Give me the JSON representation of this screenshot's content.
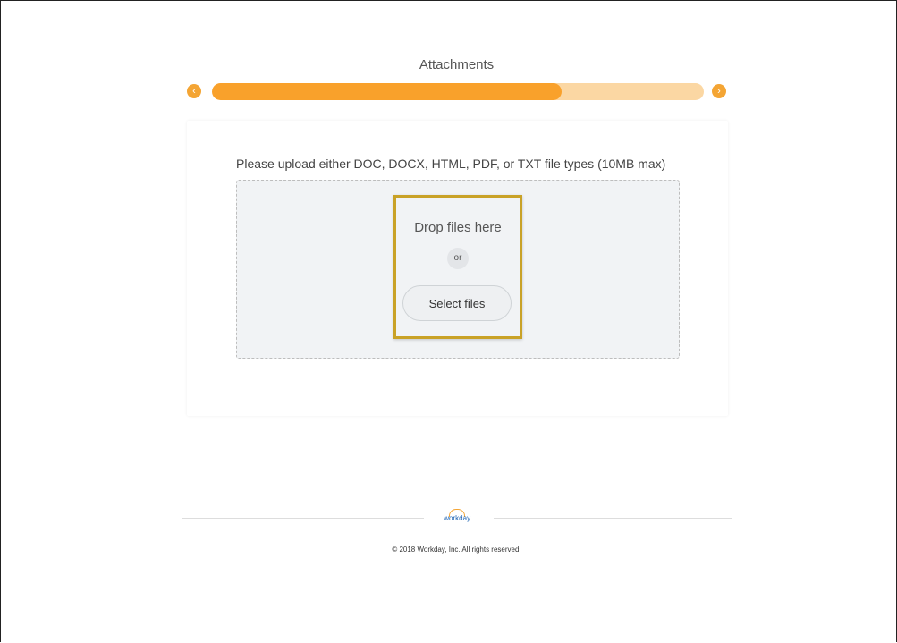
{
  "step": {
    "title": "Attachments",
    "progress": 0.71,
    "prev_icon": "chevron-left-icon",
    "next_icon": "chevron-right-icon"
  },
  "upload": {
    "instructions": "Please upload either DOC, DOCX, HTML, PDF, or TXT file types (10MB max)",
    "drop_text": "Drop files here",
    "or_text": "or",
    "select_label": "Select files"
  },
  "footer": {
    "logo_text": "workday.",
    "copyright": "© 2018 Workday, Inc. All rights reserved."
  },
  "colors": {
    "accent": "#f9a12b",
    "accent_light": "#fbd7a3",
    "highlight": "#c9a227",
    "logo_blue": "#1e64b4"
  }
}
